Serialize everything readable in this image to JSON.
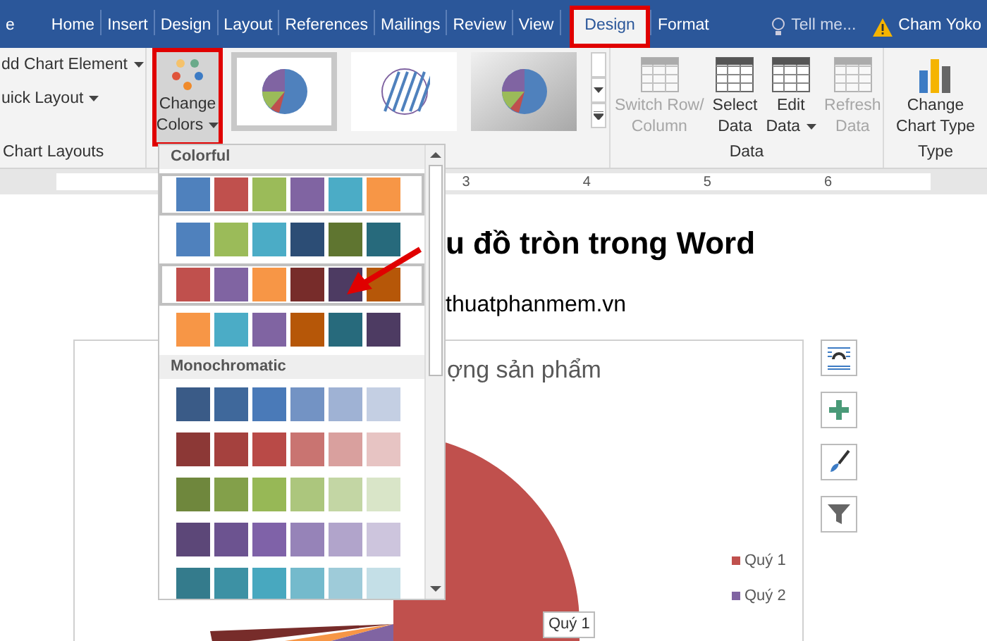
{
  "tabs": [
    {
      "label": "e",
      "selected": false
    },
    {
      "label": "Home",
      "selected": false
    },
    {
      "label": "Insert",
      "selected": false
    },
    {
      "label": "Design",
      "selected": false
    },
    {
      "label": "Layout",
      "selected": false
    },
    {
      "label": "References",
      "selected": false
    },
    {
      "label": "Mailings",
      "selected": false
    },
    {
      "label": "Review",
      "selected": false
    },
    {
      "label": "View",
      "selected": false
    },
    {
      "label": "Design",
      "selected": true
    },
    {
      "label": "Format",
      "selected": false
    }
  ],
  "tell_me": "Tell me...",
  "user": "Cham Yoko",
  "chart_layouts": {
    "items": [
      "dd Chart Element",
      "uick Layout"
    ],
    "label": "Chart Layouts"
  },
  "change_colors": {
    "label_1": "Change",
    "label_2": "Colors"
  },
  "data_group": {
    "buttons": [
      {
        "label_1": "Switch Row/",
        "label_2": "Column",
        "disabled": true
      },
      {
        "label_1": "Select",
        "label_2": "Data",
        "disabled": false
      },
      {
        "label_1": "Edit",
        "label_2": "Data",
        "disabled": false
      },
      {
        "label_1": "Refresh",
        "label_2": "Data",
        "disabled": true
      }
    ],
    "label": "Data"
  },
  "type_group": {
    "label_1": "Change",
    "label_2": "Chart Type",
    "label": "Type"
  },
  "ruler": [
    "3",
    "4",
    "5",
    "6"
  ],
  "document": {
    "title": "u đồ tròn trong Word",
    "subtitle": "thuatphanmem.vn",
    "chart_title": "ợng sản phẩm",
    "legend": [
      {
        "label": "Quý 1",
        "color": "#c0504d"
      },
      {
        "label": "Quý 2",
        "color": "#8064a2"
      }
    ],
    "data_label": "Quý 1"
  },
  "palette": {
    "sections": [
      {
        "title": "Colorful",
        "rows": [
          {
            "highlighted": true,
            "swatches": [
              {
                "color": "#4f81bd"
              },
              {
                "color": "#c0504d"
              },
              {
                "color": "#9bbb59"
              },
              {
                "color": "#8064a2"
              },
              {
                "color": "#4bacc6"
              },
              {
                "color": "#f79646"
              }
            ]
          },
          {
            "highlighted": false,
            "swatches": [
              {
                "color": "#4f81bd"
              },
              {
                "color": "#9bbb59"
              },
              {
                "color": "#4bacc6"
              },
              {
                "color": "#2c4d75"
              },
              {
                "color": "#5f7530"
              },
              {
                "color": "#276a7c"
              }
            ]
          },
          {
            "highlighted": true,
            "swatches": [
              {
                "color": "#c0504d"
              },
              {
                "color": "#8064a2"
              },
              {
                "color": "#f79646"
              },
              {
                "color": "#772c2a"
              },
              {
                "color": "#4d3b62"
              },
              {
                "color": "#b65708"
              }
            ]
          },
          {
            "highlighted": false,
            "swatches": [
              {
                "color": "#f79646"
              },
              {
                "color": "#4bacc6"
              },
              {
                "color": "#8064a2"
              },
              {
                "color": "#b65708"
              },
              {
                "color": "#276a7c"
              },
              {
                "color": "#4d3b62"
              }
            ]
          }
        ]
      },
      {
        "title": "Monochromatic",
        "rows": [
          {
            "highlighted": false,
            "swatches": [
              {
                "color": "#3a5b87"
              },
              {
                "color": "#3f689b"
              },
              {
                "color": "#4a7ab8"
              },
              {
                "color": "#7393c4"
              },
              {
                "color": "#9fb2d4"
              },
              {
                "color": "#c4cfe3"
              }
            ]
          },
          {
            "highlighted": false,
            "swatches": [
              {
                "color": "#8c3836"
              },
              {
                "color": "#a5413e"
              },
              {
                "color": "#b94a47"
              },
              {
                "color": "#c97471"
              },
              {
                "color": "#d9a09e"
              },
              {
                "color": "#e7c4c3"
              }
            ]
          },
          {
            "highlighted": false,
            "swatches": [
              {
                "color": "#6f873d"
              },
              {
                "color": "#83a04a"
              },
              {
                "color": "#97b856"
              },
              {
                "color": "#acc67d"
              },
              {
                "color": "#c3d6a4"
              },
              {
                "color": "#d9e5c8"
              }
            ]
          },
          {
            "highlighted": false,
            "swatches": [
              {
                "color": "#5c4778"
              },
              {
                "color": "#6c5390"
              },
              {
                "color": "#7f62a8"
              },
              {
                "color": "#9683b8"
              },
              {
                "color": "#b1a4cb"
              },
              {
                "color": "#cdc5dd"
              }
            ]
          },
          {
            "highlighted": false,
            "swatches": [
              {
                "color": "#347b8c"
              },
              {
                "color": "#3d91a4"
              },
              {
                "color": "#48a8bf"
              },
              {
                "color": "#74bacc"
              },
              {
                "color": "#9ecbd9"
              },
              {
                "color": "#c4dfe7"
              }
            ]
          }
        ]
      }
    ]
  }
}
